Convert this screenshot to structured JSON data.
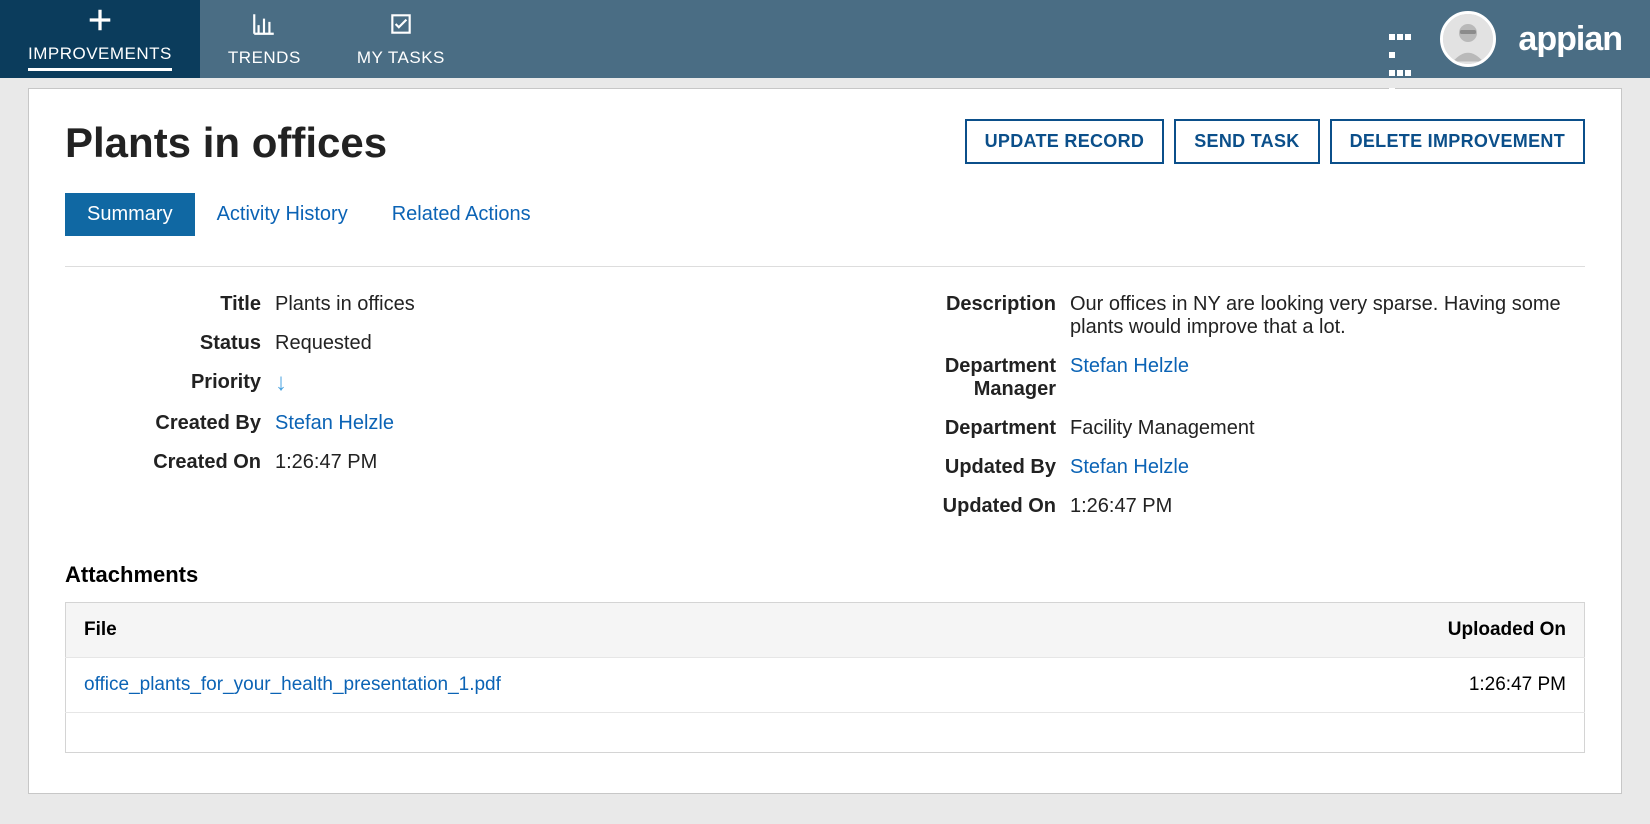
{
  "brand": "appian",
  "nav": {
    "items": [
      {
        "label": "IMPROVEMENTS",
        "icon": "plus",
        "active": true
      },
      {
        "label": "TRENDS",
        "icon": "bar-chart",
        "active": false
      },
      {
        "label": "MY TASKS",
        "icon": "check-box",
        "active": false
      }
    ]
  },
  "record": {
    "title": "Plants in offices",
    "actions": {
      "update": "UPDATE RECORD",
      "send_task": "SEND TASK",
      "delete": "DELETE IMPROVEMENT"
    },
    "tabs": [
      {
        "label": "Summary",
        "active": true
      },
      {
        "label": "Activity History",
        "active": false
      },
      {
        "label": "Related Actions",
        "active": false
      }
    ],
    "fields": {
      "title_label": "Title",
      "title_value": "Plants in offices",
      "status_label": "Status",
      "status_value": "Requested",
      "priority_label": "Priority",
      "priority_icon": "arrow-down",
      "created_by_label": "Created By",
      "created_by_value": "Stefan Helzle",
      "created_on_label": "Created On",
      "created_on_value": "1:26:47 PM",
      "description_label": "Description",
      "description_value": "Our offices in NY are looking very sparse. Having some plants would improve that a lot.",
      "dept_manager_label": "Department Manager",
      "dept_manager_value": "Stefan Helzle",
      "department_label": "Department",
      "department_value": "Facility Management",
      "updated_by_label": "Updated By",
      "updated_by_value": "Stefan Helzle",
      "updated_on_label": "Updated On",
      "updated_on_value": "1:26:47 PM"
    },
    "attachments": {
      "heading": "Attachments",
      "columns": {
        "file": "File",
        "uploaded_on": "Uploaded On"
      },
      "rows": [
        {
          "file": "office_plants_for_your_health_presentation_1.pdf",
          "uploaded_on": "1:26:47 PM"
        }
      ]
    }
  }
}
